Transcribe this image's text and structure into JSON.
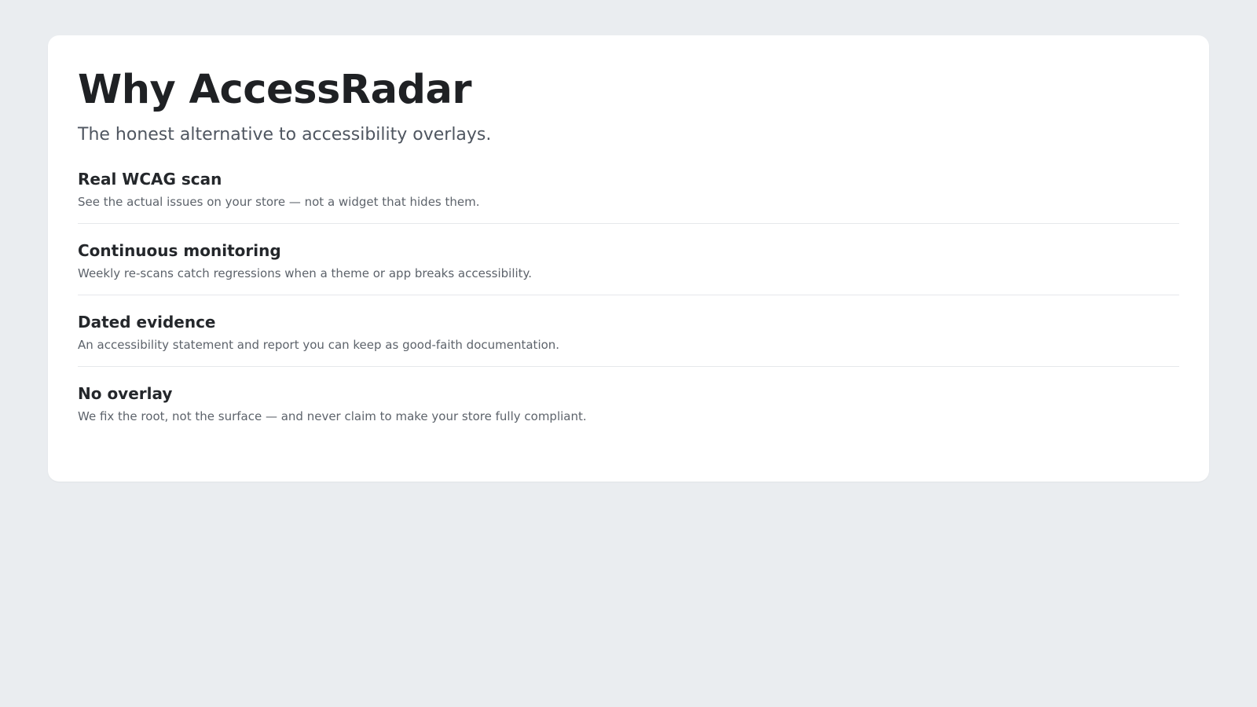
{
  "page": {
    "title": "Why AccessRadar",
    "subtitle": "The honest alternative to accessibility overlays."
  },
  "features": [
    {
      "title": "Real WCAG scan",
      "description": "See the actual issues on your store — not a widget that hides them."
    },
    {
      "title": "Continuous monitoring",
      "description": "Weekly re-scans catch regressions when a theme or app breaks accessibility."
    },
    {
      "title": "Dated evidence",
      "description": "An accessibility statement and report you can keep as good-faith documentation."
    },
    {
      "title": "No overlay",
      "description": "We fix the root, not the surface — and never claim to make your store fully compliant."
    }
  ],
  "colors": {
    "background": "#eaedf0",
    "card": "#ffffff",
    "heading": "#1f2124",
    "muted_text": "#5d636b",
    "divider": "#e6e8eb"
  }
}
